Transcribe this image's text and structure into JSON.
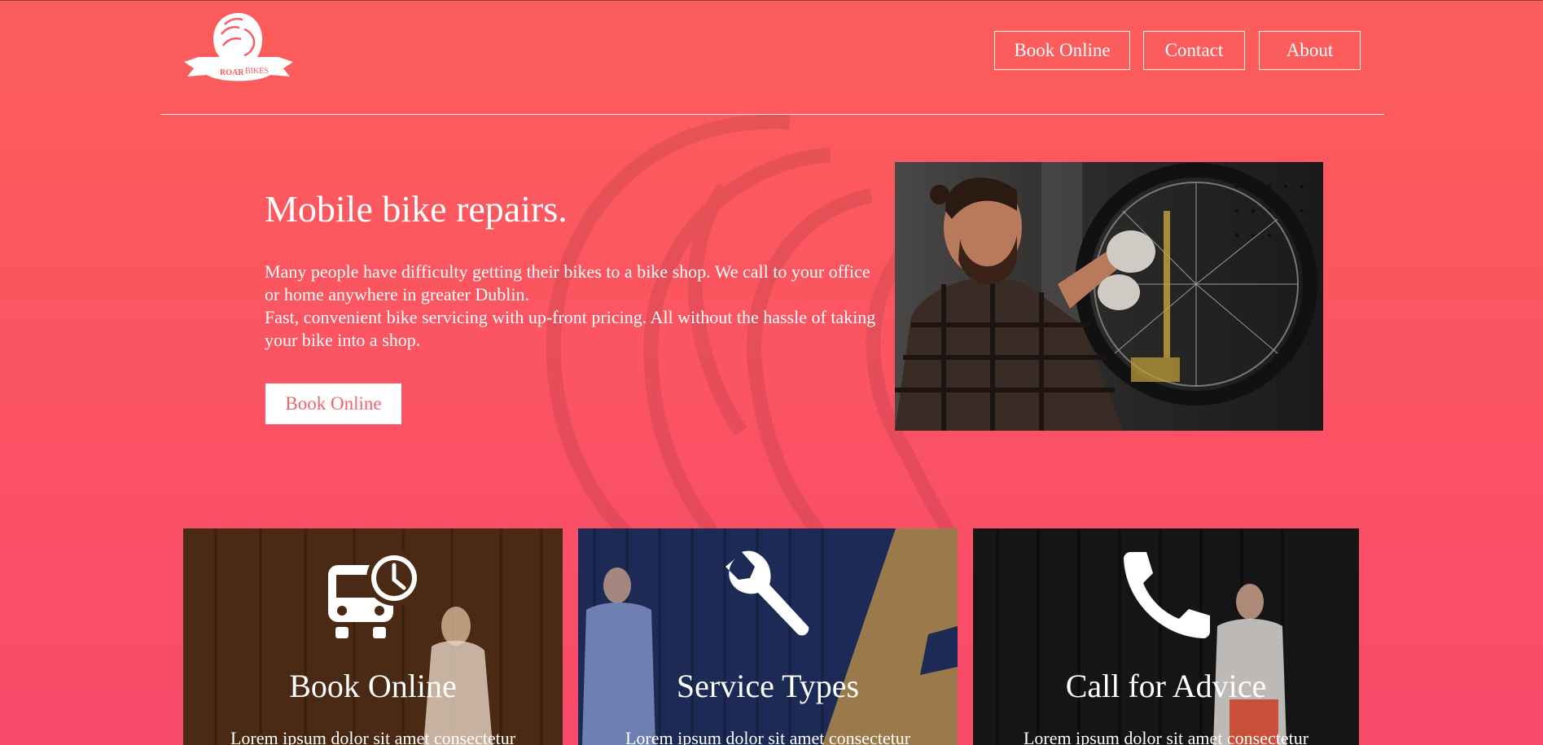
{
  "header": {
    "logo_alt": "ROAR BIKES",
    "nav": [
      "Book Online",
      "Contact",
      "About"
    ]
  },
  "hero": {
    "title": "Mobile bike repairs.",
    "paragraph1": "Many people have difficulty getting their bikes to a bike shop. We call to your office or home anywhere in greater Dublin.",
    "paragraph2": "Fast, convenient bike servicing with up-front pricing. All without the hassle of taking your bike into a shop.",
    "button": "Book Online",
    "image_alt": "Mechanic servicing a bicycle wheel in a workshop"
  },
  "cards": [
    {
      "icon": "van-clock-icon",
      "title": "Book Online",
      "text": "Lorem ipsum dolor sit amet consectetur"
    },
    {
      "icon": "wrench-icon",
      "title": "Service Types",
      "text": "Lorem ipsum dolor sit amet consectetur"
    },
    {
      "icon": "phone-icon",
      "title": "Call for Advice",
      "text": "Lorem ipsum dolor sit amet consectetur"
    }
  ],
  "colors": {
    "background_top": "#fc5d5b",
    "background_bottom": "#f94a6a",
    "button_text": "#f3636a"
  }
}
